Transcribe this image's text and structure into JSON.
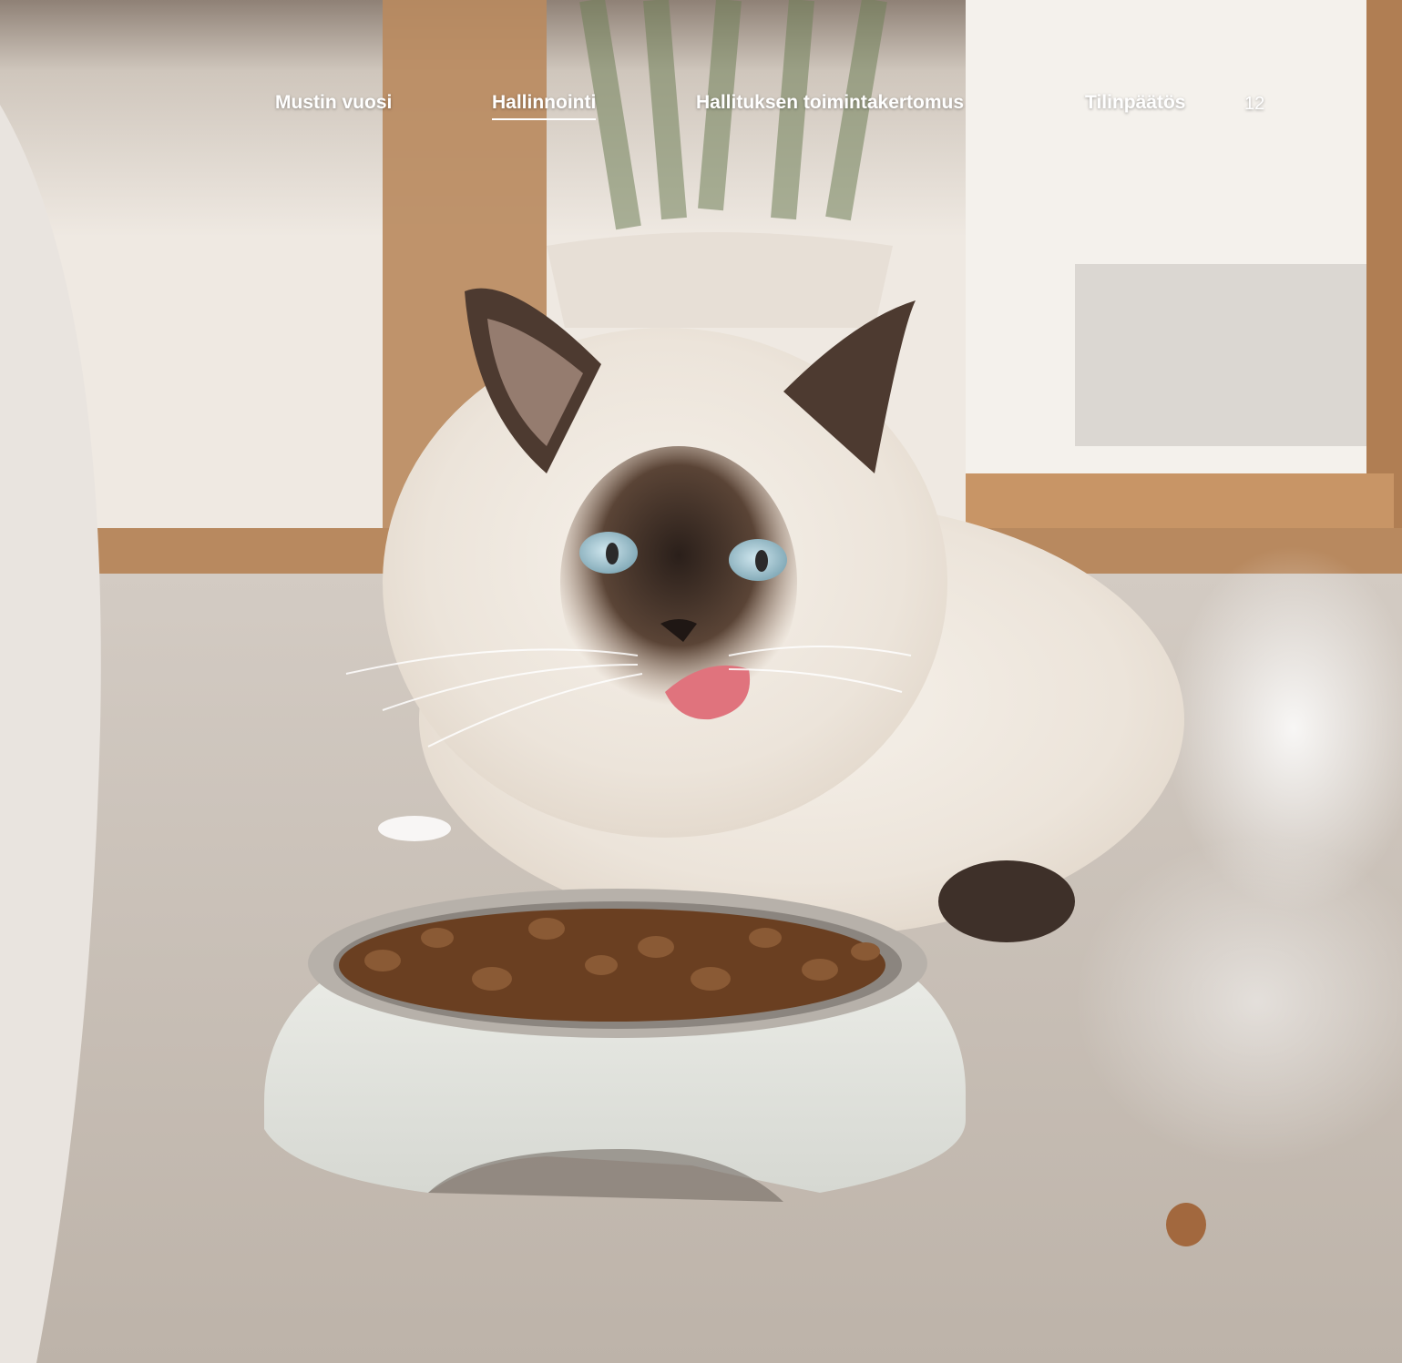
{
  "nav": {
    "items": [
      {
        "label": "Mustin vuosi",
        "active": false
      },
      {
        "label": "Hallinnointi",
        "active": true
      },
      {
        "label": "Hallituksen toimintakertomus",
        "active": false
      },
      {
        "label": "Tilinpäätös",
        "active": false
      }
    ],
    "page_number": "12"
  },
  "colors": {
    "panel": "#e9e4df",
    "nav_text": "#ffffff"
  }
}
